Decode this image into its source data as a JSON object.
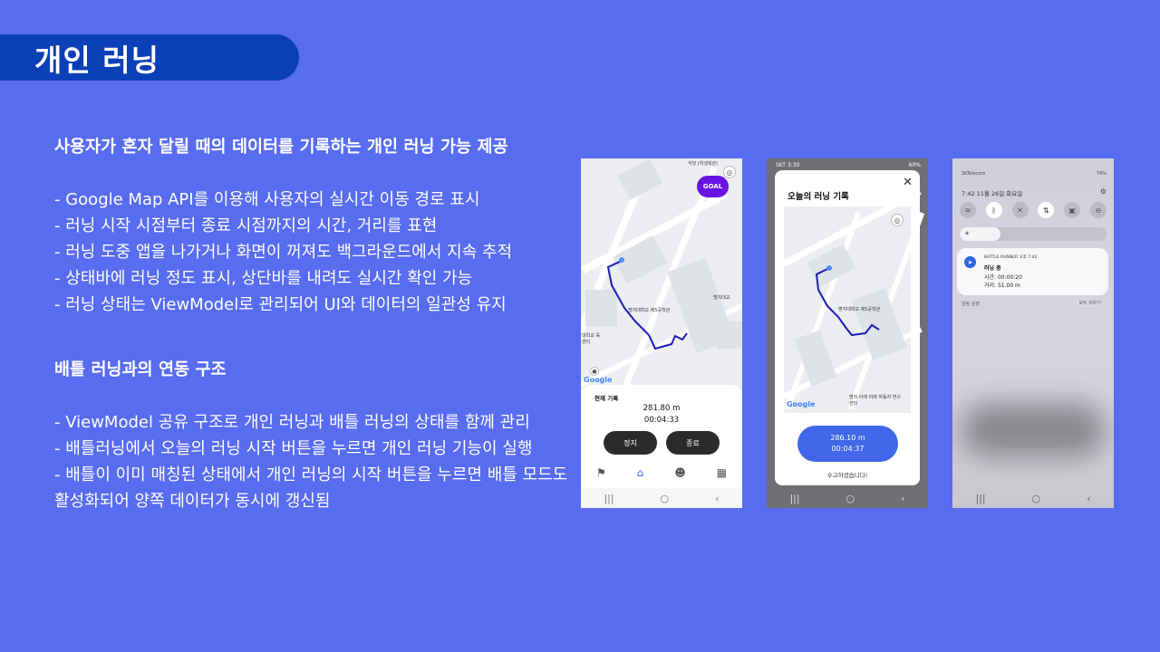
{
  "slide": {
    "title": "개인 러닝",
    "section1": {
      "heading": "사용자가 혼자 달릴 때의 데이터를 기록하는 개인 러닝 가능 제공",
      "bullets": [
        "- Google Map API를 이용해 사용자의 실시간 이동 경로 표시",
        "- 러닝 시작 시점부터 종료 시점까지의 시간, 거리를 표현",
        "- 러닝 도중 앱을 나가거나 화면이 꺼져도 백그라운드에서 지속 추적",
        "- 상태바에 러닝 정도 표시, 상단바를 내려도 실시간 확인 가능",
        "- 러닝 상태는 ViewModel로 관리되어 UI와 데이터의 일관성 유지"
      ]
    },
    "section2": {
      "heading": "배틀 러닝과의 연동 구조",
      "bullets": [
        "- ViewModel 공유 구조로 개인 러닝과 배틀 러닝의 상태를 함께 관리",
        "- 배틀러닝에서 오늘의 러닝 시작 버튼을 누르면 개인 러닝 기능이 실행",
        "- 배틀이 이미 매칭된 상태에서 개인 러닝의 시작 버튼을 누르면 배틀 모드도",
        "활성화되어 양쪽 데이터가 동시에 갱신됨"
      ]
    }
  },
  "phone1": {
    "goal_label": "GOAL",
    "map_labels": [
      "식당 (학생회관)",
      "명지대학교 제5공학관",
      "명지대학교 인문캠퍼스 학생회관",
      "명지대교",
      "대학교 육센터",
      "명지대학교 자연캠퍼스 체육관"
    ],
    "google_label": "Google",
    "record_label": "현재 기록",
    "distance": "281.80 m",
    "time": "00:04:33",
    "stop_label": "정지",
    "end_label": "종료",
    "tabs": [
      "flag-icon",
      "home-icon",
      "group-icon",
      "grid-icon"
    ]
  },
  "phone2": {
    "status_time": "SKT 3:30",
    "status_right": "60%",
    "dialog_title": "오늘의 러닝 기록",
    "map_labels": [
      "명지대학교 제5공학관",
      "명지대학교 중앙도서관",
      "명지·아레 미래 자동차 연구센터"
    ],
    "google_label": "Google",
    "distance": "286.10 m",
    "time": "00:04:37",
    "thanks": "수고하셨습니다!"
  },
  "phone3": {
    "carrier": "SKTelecom",
    "battery": "74%",
    "date": "7:42  11월 26일 화요일",
    "notif_app": "BATTLE RUNNER  오후 7:42",
    "notif_title": "러닝 중",
    "notif_time": "시간: 00:00:20",
    "notif_distance": "거리: 51.00 m",
    "footer_left": "알림 설정",
    "footer_right": "모두 지우기"
  },
  "colors": {
    "background": "#586cf0",
    "title_pill": "#0a3fb8",
    "goal": "#6a12e6",
    "accent_blue": "#3f67e8",
    "route": "#1b1bb5"
  }
}
